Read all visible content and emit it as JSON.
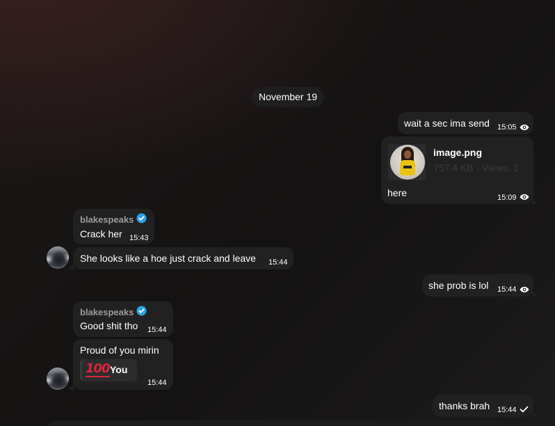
{
  "chat": {
    "date_separator": "November 19",
    "messages": [
      {
        "text": "wait a sec ima send",
        "time": "15:05",
        "status_icon": "eye-icon"
      },
      {
        "file_name": "image.png",
        "file_meta": "757.4 KB · Views: 1",
        "caption": "here",
        "time": "15:09",
        "status_icon": "eye-icon"
      },
      {
        "sender": "blakespeaks",
        "verified_icon": "verified-badge-icon",
        "text": "Crack her",
        "time": "15:43"
      },
      {
        "text": "She looks like a hoe just crack and leave",
        "time": "15:44"
      },
      {
        "text": "she prob is lol",
        "time": "15:44",
        "status_icon": "eye-icon"
      },
      {
        "sender": "blakespeaks",
        "verified_icon": "verified-badge-icon",
        "text": "Good shit tho",
        "time": "15:44"
      },
      {
        "text": "Proud of you mirin",
        "reaction": {
          "emoji_icon": "hundred-points-icon",
          "emoji_text": "100",
          "label": "You"
        },
        "time": "15:44"
      },
      {
        "text": "thanks brah",
        "time": "15:44",
        "status_icon": "checkmark-icon"
      }
    ]
  },
  "colors": {
    "bubble": "#212121",
    "verified_badge": "#2aa1e8",
    "hundred_points": "#d8263a"
  }
}
